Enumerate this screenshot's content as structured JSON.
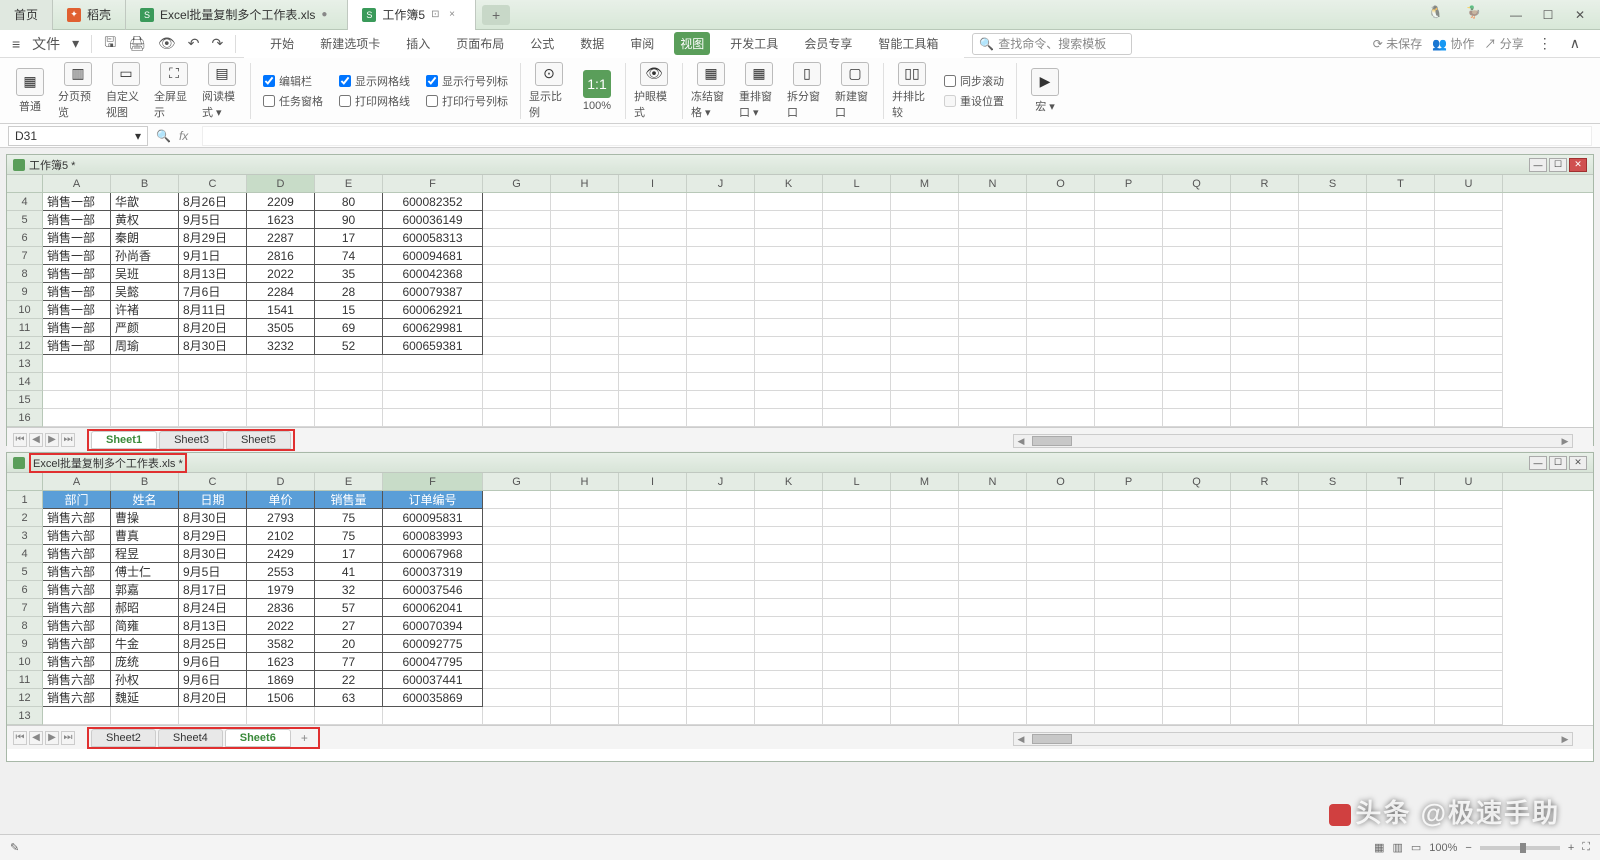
{
  "titlebar": {
    "tabs": [
      {
        "label": "首页",
        "icon": ""
      },
      {
        "label": "稻壳",
        "icon": "orange"
      },
      {
        "label": "Excel批量复制多个工作表.xls",
        "icon": "S",
        "close": true
      },
      {
        "label": "工作簿5",
        "icon": "S",
        "close": true,
        "active": true
      }
    ],
    "add": "+"
  },
  "menubar": {
    "file": "文件",
    "tabs": [
      "开始",
      "新建选项卡",
      "插入",
      "页面布局",
      "公式",
      "数据",
      "审阅",
      "视图",
      "开发工具",
      "会员专享",
      "智能工具箱"
    ],
    "active": "视图",
    "search": "查找命令、搜索模板",
    "right": {
      "unsaved": "未保存",
      "coop": "协作",
      "share": "分享"
    }
  },
  "ribbon": {
    "big": [
      {
        "label": "普通",
        "icon": "▦"
      },
      {
        "label": "分页预览",
        "icon": "▥"
      },
      {
        "label": "自定义视图",
        "icon": "▭"
      },
      {
        "label": "全屏显示",
        "icon": "⛶"
      },
      {
        "label": "阅读模式",
        "icon": "▤",
        "dd": true
      }
    ],
    "checks1": [
      {
        "label": "编辑栏",
        "checked": true
      },
      {
        "label": "任务窗格",
        "checked": false
      }
    ],
    "checks2": [
      {
        "label": "显示网格线",
        "checked": true
      },
      {
        "label": "打印网格线",
        "checked": false
      }
    ],
    "checks3": [
      {
        "label": "显示行号列标",
        "checked": true
      },
      {
        "label": "打印行号列标",
        "checked": false
      }
    ],
    "big2": [
      {
        "label": "显示比例",
        "icon": "⊙"
      },
      {
        "label": "100%",
        "icon": "1:1",
        "active": true
      },
      {
        "label": "护眼模式",
        "icon": "👁"
      },
      {
        "label": "冻结窗格",
        "icon": "▦",
        "dd": true
      },
      {
        "label": "重排窗口",
        "icon": "▦",
        "dd": true
      },
      {
        "label": "拆分窗口",
        "icon": "▯"
      },
      {
        "label": "新建窗口",
        "icon": "▢"
      },
      {
        "label": "并排比较",
        "icon": "▯▯"
      }
    ],
    "side": [
      {
        "label": "同步滚动",
        "checked": false
      },
      {
        "label": "重设位置",
        "disabled": true
      }
    ],
    "macro": {
      "label": "宏",
      "dd": true
    }
  },
  "namebox": {
    "cell": "D31",
    "fx": "fx"
  },
  "wb1": {
    "title": "工作簿5 *",
    "cols": [
      "A",
      "B",
      "C",
      "D",
      "E",
      "F",
      "G",
      "H",
      "I",
      "J",
      "K",
      "L",
      "M",
      "N",
      "O",
      "P",
      "Q",
      "R",
      "S",
      "T",
      "U"
    ],
    "rows": [
      {
        "n": 4,
        "c": [
          "销售一部",
          "华歆",
          "8月26日",
          "2209",
          "80",
          "600082352"
        ]
      },
      {
        "n": 5,
        "c": [
          "销售一部",
          "黄权",
          "9月5日",
          "1623",
          "90",
          "600036149"
        ]
      },
      {
        "n": 6,
        "c": [
          "销售一部",
          "秦朗",
          "8月29日",
          "2287",
          "17",
          "600058313"
        ]
      },
      {
        "n": 7,
        "c": [
          "销售一部",
          "孙尚香",
          "9月1日",
          "2816",
          "74",
          "600094681"
        ]
      },
      {
        "n": 8,
        "c": [
          "销售一部",
          "吴班",
          "8月13日",
          "2022",
          "35",
          "600042368"
        ]
      },
      {
        "n": 9,
        "c": [
          "销售一部",
          "吴懿",
          "7月6日",
          "2284",
          "28",
          "600079387"
        ]
      },
      {
        "n": 10,
        "c": [
          "销售一部",
          "许褚",
          "8月11日",
          "1541",
          "15",
          "600062921"
        ]
      },
      {
        "n": 11,
        "c": [
          "销售一部",
          "严颜",
          "8月20日",
          "3505",
          "69",
          "600629981"
        ]
      },
      {
        "n": 12,
        "c": [
          "销售一部",
          "周瑜",
          "8月30日",
          "3232",
          "52",
          "600659381"
        ]
      },
      {
        "n": 13,
        "c": [
          "",
          "",
          "",
          "",
          "",
          ""
        ]
      },
      {
        "n": 14,
        "c": [
          "",
          "",
          "",
          "",
          "",
          ""
        ]
      },
      {
        "n": 15,
        "c": [
          "",
          "",
          "",
          "",
          "",
          ""
        ]
      },
      {
        "n": 16,
        "c": [
          "",
          "",
          "",
          "",
          "",
          ""
        ]
      }
    ],
    "sheets": [
      "Sheet1",
      "Sheet3",
      "Sheet5"
    ],
    "activeSheet": "Sheet1"
  },
  "wb2": {
    "title": "Excel批量复制多个工作表.xls *",
    "cols": [
      "A",
      "B",
      "C",
      "D",
      "E",
      "F",
      "G",
      "H",
      "I",
      "J",
      "K",
      "L",
      "M",
      "N",
      "O",
      "P",
      "Q",
      "R",
      "S",
      "T",
      "U"
    ],
    "headers": [
      "部门",
      "姓名",
      "日期",
      "单价",
      "销售量",
      "订单编号"
    ],
    "rows": [
      {
        "n": 2,
        "c": [
          "销售六部",
          "曹操",
          "8月30日",
          "2793",
          "75",
          "600095831"
        ]
      },
      {
        "n": 3,
        "c": [
          "销售六部",
          "曹真",
          "8月29日",
          "2102",
          "75",
          "600083993"
        ]
      },
      {
        "n": 4,
        "c": [
          "销售六部",
          "程昱",
          "8月30日",
          "2429",
          "17",
          "600067968"
        ]
      },
      {
        "n": 5,
        "c": [
          "销售六部",
          "傅士仁",
          "9月5日",
          "2553",
          "41",
          "600037319"
        ]
      },
      {
        "n": 6,
        "c": [
          "销售六部",
          "郭嘉",
          "8月17日",
          "1979",
          "32",
          "600037546"
        ]
      },
      {
        "n": 7,
        "c": [
          "销售六部",
          "郝昭",
          "8月24日",
          "2836",
          "57",
          "600062041"
        ]
      },
      {
        "n": 8,
        "c": [
          "销售六部",
          "简雍",
          "8月13日",
          "2022",
          "27",
          "600070394"
        ]
      },
      {
        "n": 9,
        "c": [
          "销售六部",
          "牛金",
          "8月25日",
          "3582",
          "20",
          "600092775"
        ]
      },
      {
        "n": 10,
        "c": [
          "销售六部",
          "庞统",
          "9月6日",
          "1623",
          "77",
          "600047795"
        ]
      },
      {
        "n": 11,
        "c": [
          "销售六部",
          "孙权",
          "9月6日",
          "1869",
          "22",
          "600037441"
        ]
      },
      {
        "n": 12,
        "c": [
          "销售六部",
          "魏延",
          "8月20日",
          "1506",
          "63",
          "600035869"
        ]
      },
      {
        "n": 13,
        "c": [
          "",
          "",
          "",
          "",
          "",
          ""
        ]
      }
    ],
    "sheets": [
      "Sheet2",
      "Sheet4",
      "Sheet6"
    ],
    "activeSheet": "Sheet6",
    "add": "+"
  },
  "statusbar": {
    "zoom": "100%",
    "minus": "−",
    "plus": "+"
  },
  "watermark": "头条 @极速手助"
}
